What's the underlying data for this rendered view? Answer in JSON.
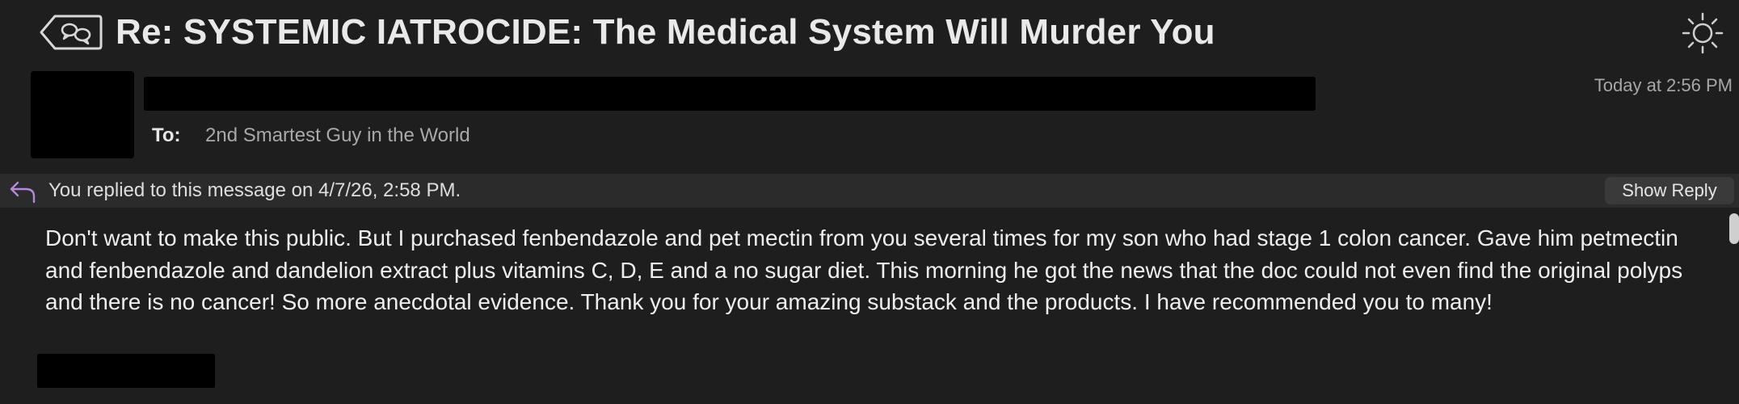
{
  "header": {
    "title": "Re: SYSTEMIC IATROCIDE: The Medical System Will Murder You",
    "back_icon": "conversation-back-icon",
    "appearance_icon": "sun-icon"
  },
  "message": {
    "to_label": "To:",
    "to_value": "2nd Smartest Guy in the World",
    "date": "Today at 2:56 PM"
  },
  "reply_banner": {
    "text": "You replied to this message on 4/7/26, 2:58 PM.",
    "button_label": "Show Reply",
    "icon": "reply-arrow-icon"
  },
  "body": {
    "text": "Don't want to make this public. But I purchased fenbendazole and pet mectin from you several times for my son who had stage 1 colon cancer. Gave him petmectin and fenbendazole and dandelion extract plus vitamins C, D, E and a no sugar diet. This morning he got the news that the doc could not even find the original polyps and there is no cancer! So more anecdotal evidence.  Thank you for your amazing substack and the products. I have recommended you to many!"
  },
  "colors": {
    "background": "#1e1e1e",
    "banner": "#2b2b2b",
    "reply_icon": "#b48ad9",
    "redaction": "#000000"
  }
}
